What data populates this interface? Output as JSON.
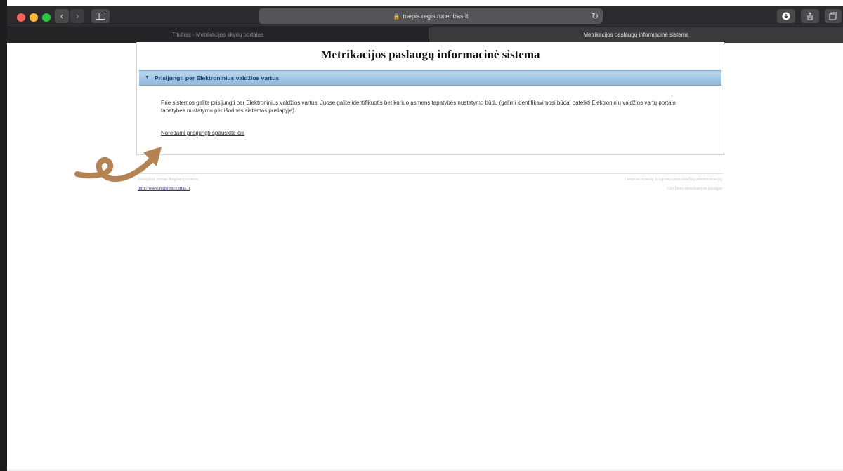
{
  "browser": {
    "url": "mepis.registrucentras.lt",
    "tabs": [
      {
        "label": "Titulinis - Metrikacijos skyrių portalas",
        "active": false
      },
      {
        "label": "Metrikacijos paslaugų informacinė sistema",
        "active": true
      }
    ],
    "icons": {
      "back": "chevron-left-icon",
      "forward": "chevron-right-icon",
      "sidebar": "sidebar-icon",
      "reload": "reload-icon",
      "download": "download-icon",
      "share": "share-icon",
      "tabs_overview": "tabs-icon"
    }
  },
  "page": {
    "title": "Metrikacijos paslaugų informacinė sistema",
    "section": {
      "title": "Prisijungti per Elektroninius valdžios vartus",
      "body": "Prie sistemos galite prisijungti per Elektroninius valdžios vartus. Juose galite identifikuotis bet kuriuo asmens tapatybės nustatymo būdu (galimi identifikavimosi būdai pateikti Elektroninių valdžios vartų portalo tapatybės nustatymo per išorines sistemas puslapyje).",
      "link": "Norėdami prisijungti spauskite čia"
    },
    "footer": {
      "left_text": "Valstybės įmonė Registrų centras",
      "left_link": "http://www.registrucentras.lt",
      "right_text1": "Lietuvos miestų ir rajonų savivaldybių administracijų",
      "right_text2": "Civilinės metrikacijos įstaigos"
    }
  },
  "colors": {
    "section_bar": "#a5c9e6",
    "annotation_arrow": "#b5834f"
  }
}
